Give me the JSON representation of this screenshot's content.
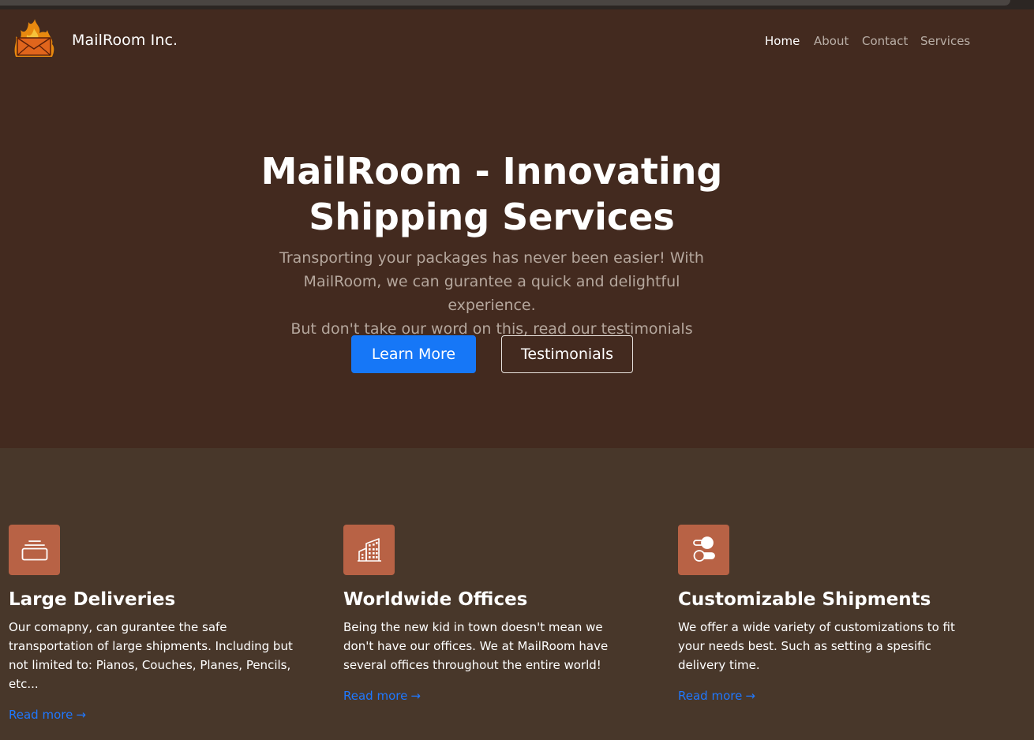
{
  "navbar": {
    "brand": "MailRoom Inc.",
    "logo_icon": "flaming-envelope-icon",
    "links": [
      {
        "label": "Home",
        "active": true
      },
      {
        "label": "About",
        "active": false
      },
      {
        "label": "Contact",
        "active": false
      },
      {
        "label": "Services",
        "active": false
      }
    ]
  },
  "hero": {
    "title_line1": "MailRoom - Innovating",
    "title_line2": "Shipping Services",
    "lead_line1": "Transporting your packages has never been easier! With",
    "lead_line2": "MailRoom, we can gurantee a quick and delightful experience.",
    "lead_line3": "But don't take our word on this, read our testimonials",
    "primary_button": "Learn More",
    "secondary_button": "Testimonials"
  },
  "features": [
    {
      "icon": "collection-icon",
      "title": "Large Deliveries",
      "text": "Our comapny, can gurantee the safe transportation of large shipments. Including but not limited to: Pianos, Couches, Planes, Pencils, etc...",
      "link": "Read more"
    },
    {
      "icon": "building-icon",
      "title": "Worldwide Offices",
      "text": "Being the new kid in town doesn't mean we don't have our offices. We at MailRoom have several offices throughout the entire world!",
      "link": "Read more"
    },
    {
      "icon": "toggles-icon",
      "title": "Customizable Shipments",
      "text": "We offer a wide variety of customizations to fit your needs best. Such as setting a spesific delivery time.",
      "link": "Read more"
    }
  ],
  "colors": {
    "hero_bg": "#432a1f",
    "features_bg": "#48372a",
    "icon_bg": "#b86245",
    "primary": "#1677f7",
    "link": "#1f78ff"
  }
}
